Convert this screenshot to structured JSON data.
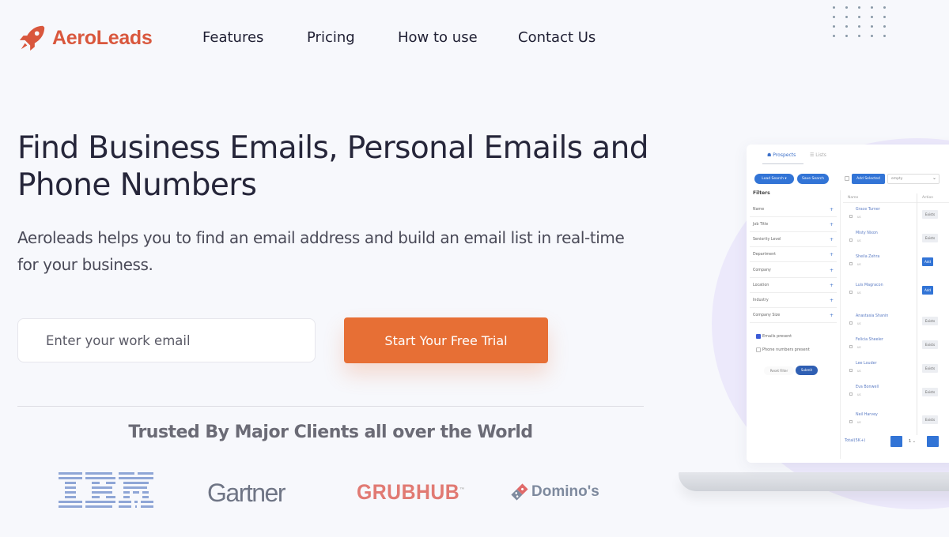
{
  "brand": {
    "name": "AeroLeads",
    "logo_icon": "rocket-icon",
    "color": "#d9573d"
  },
  "nav": {
    "links": [
      {
        "label": "Features"
      },
      {
        "label": "Pricing"
      },
      {
        "label": "How to use"
      },
      {
        "label": "Contact Us"
      }
    ]
  },
  "hero": {
    "headline": "Find Business Emails, Personal Emails and Phone Numbers",
    "subtext": "Aeroleads helps you to find an email address and build an email list in real-time for your business.",
    "email_placeholder": "Enter your work email",
    "email_value": "",
    "cta_label": "Start Your Free Trial",
    "cta_color": "#e76f35"
  },
  "clients": {
    "heading": "Trusted By Major Clients all over the World",
    "logos": [
      {
        "name": "IBM"
      },
      {
        "name": "Gartner"
      },
      {
        "name": "GRUBHUB",
        "mark": "™"
      },
      {
        "name": "Domino's"
      }
    ]
  },
  "mockup": {
    "tabs": [
      {
        "label": "Prospects",
        "icon": "people-icon",
        "active": true
      },
      {
        "label": "Lists",
        "icon": "list-icon",
        "active": false
      }
    ],
    "toolbar": {
      "load_search": "Load Search",
      "save_search": "Save Search",
      "add_selected": "Add Selected",
      "list_select_value": "empty"
    },
    "filters": {
      "title": "Filters",
      "items": [
        "Name",
        "Job Title",
        "Seniority Level",
        "Department",
        "Company",
        "Location",
        "Industry",
        "Company Size"
      ],
      "checkboxes": [
        {
          "label": "Emails present",
          "checked": true
        },
        {
          "label": "Phone numbers present",
          "checked": false
        }
      ],
      "reset_label": "Reset Filter",
      "submit_label": "Submit"
    },
    "table": {
      "headers": [
        "Name",
        "Action"
      ],
      "rows": [
        {
          "name": "Grace Turner",
          "sub": "us",
          "action": "Exists"
        },
        {
          "name": "Misty Nixon",
          "sub": "us",
          "action": "Exists"
        },
        {
          "name": "Sheila Zehra",
          "sub": "us",
          "action": "Add"
        },
        {
          "name": "Luis Magracon",
          "sub": "us",
          "action": "Add"
        },
        {
          "name": "Anastasia Shanin",
          "sub": "us",
          "action": "Exists"
        },
        {
          "name": "Felicia Sheeler",
          "sub": "us",
          "action": "Exists"
        },
        {
          "name": "Lee Louder",
          "sub": "us",
          "action": "Exists"
        },
        {
          "name": "Eva Bonwell",
          "sub": "us",
          "action": "Exists"
        },
        {
          "name": "Neil Harvey",
          "sub": "us",
          "action": "Exists"
        }
      ],
      "total_label": "Total(5K+)",
      "page_value": "1"
    }
  }
}
